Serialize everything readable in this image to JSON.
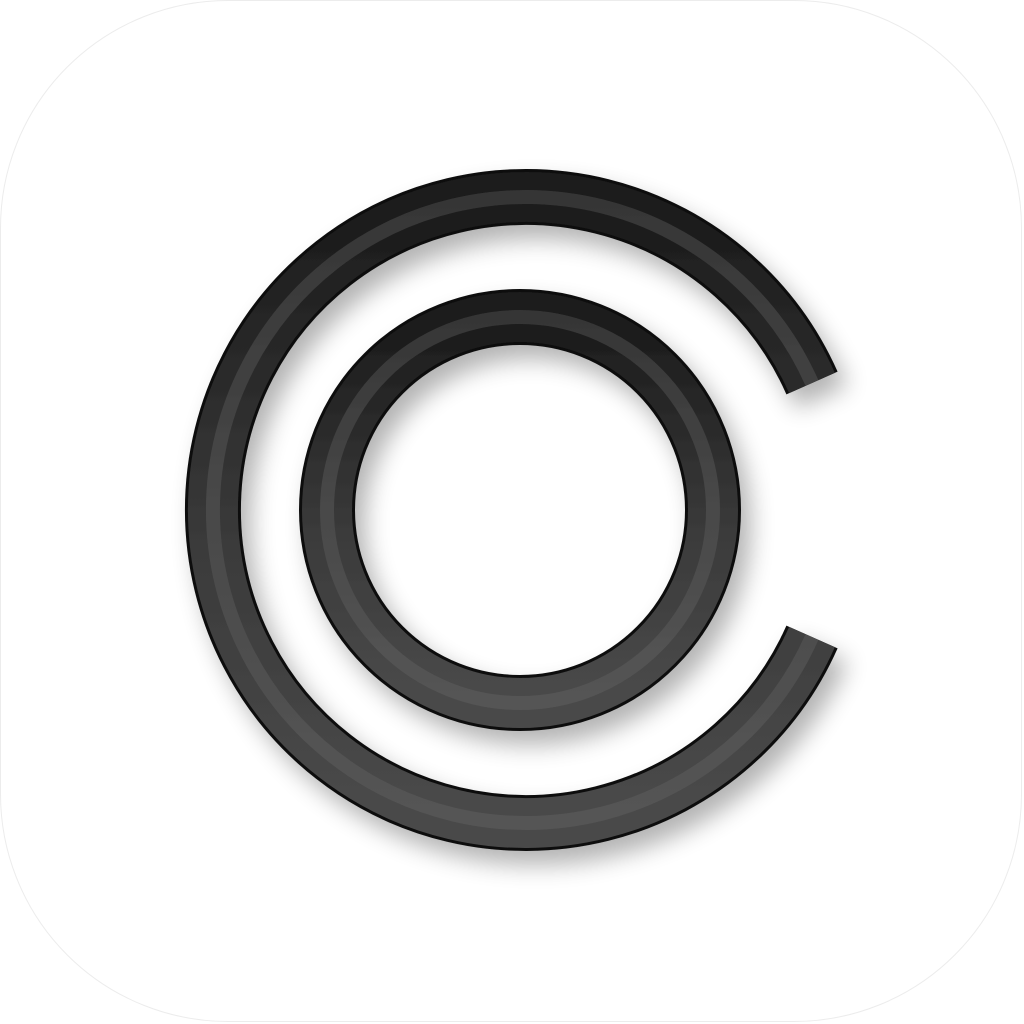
{
  "app_icon": {
    "tile_color": "#ffffff",
    "tile_border_color": "#ececec",
    "logo_icon": "open-c-with-ring-icon",
    "logo_color": "#3a3a3a",
    "logo_highlight_color": "#6a6a6a",
    "logo_shadow_color": "#0a0a0a"
  }
}
